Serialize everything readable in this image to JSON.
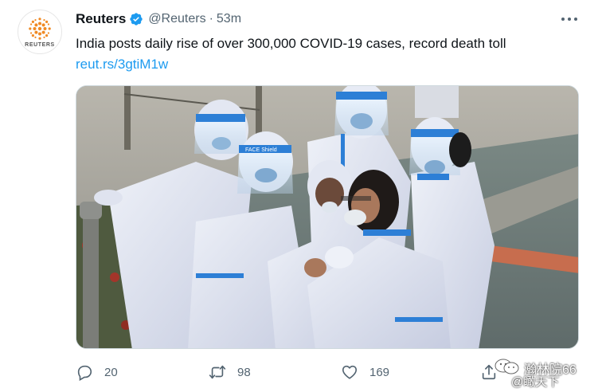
{
  "account": {
    "name": "Reuters",
    "handle": "@Reuters",
    "separator": "·",
    "time": "53m",
    "avatar_word": "REUTERS"
  },
  "tweet": {
    "text": "India posts daily rise of over 300,000 COVID-19 cases, record death toll",
    "link": "reut.rs/3gtiM1w"
  },
  "media": {
    "shield_label": "FACE Shield"
  },
  "actions": {
    "replies": "20",
    "retweets": "98",
    "likes": "169"
  },
  "watermark": {
    "line1": "瀚林院66",
    "line2": "@瞰天下"
  },
  "colors": {
    "link": "#1d9bf0",
    "verified": "#1d9bf0",
    "secondary_text": "#536471",
    "primary_text": "#0f1419",
    "avatar_accent": "#f08a24"
  },
  "icons": {
    "reply": "reply-icon",
    "retweet": "retweet-icon",
    "like": "heart-icon",
    "share": "share-icon",
    "more": "more-icon",
    "verified": "verified-badge-icon"
  }
}
